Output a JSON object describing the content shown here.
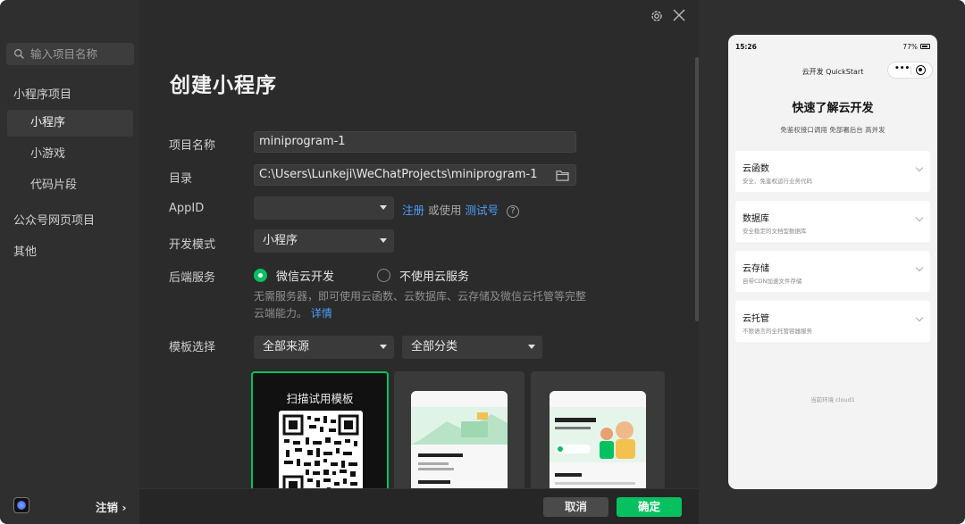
{
  "sidebar": {
    "search_placeholder": "输入项目名称",
    "section_miniprogram": "小程序项目",
    "items": [
      "小程序",
      "小游戏",
      "代码片段"
    ],
    "section_official": "公众号网页项目",
    "section_other": "其他",
    "logout": "注销 ›"
  },
  "main": {
    "title": "创建小程序",
    "labels": {
      "name": "项目名称",
      "dir": "目录",
      "appid": "AppID",
      "mode": "开发模式",
      "backend": "后端服务",
      "template": "模板选择"
    },
    "project_name": "miniprogram-1",
    "directory": "C:\\Users\\Lunkeji\\WeChatProjects\\miniprogram-1",
    "appid_value": "",
    "appid_register": "注册",
    "appid_or_use": "或使用",
    "appid_test": "测试号",
    "mode_value": "小程序",
    "backend_options": [
      "微信云开发",
      "不使用云服务"
    ],
    "backend_selected": "微信云开发",
    "backend_desc": "无需服务器，即可使用云函数、云数据库、云存储及微信云托管等完整云端能力。",
    "backend_detail": "详情",
    "template_source": "全部来源",
    "template_category": "全部分类",
    "template_qr_title": "扫描试用模板"
  },
  "footer": {
    "cancel": "取消",
    "confirm": "确定"
  },
  "preview": {
    "time": "15:26",
    "battery": "77%",
    "nav_title": "云开发 QuickStart",
    "heading": "快速了解云开发",
    "subheading": "免鉴权接口调用 免部署后台 高并发",
    "cards": [
      {
        "title": "云函数",
        "desc": "安全、免鉴权运行业务代码"
      },
      {
        "title": "数据库",
        "desc": "安全稳定的文档型数据库"
      },
      {
        "title": "云存储",
        "desc": "自带CDN加速文件存储"
      },
      {
        "title": "云托管",
        "desc": "不限语言的全托管容器服务"
      }
    ],
    "env": "当前环境 cloud1"
  },
  "colors": {
    "accent": "#07c160",
    "link": "#4a9eff",
    "background": "#2b2b2b"
  }
}
